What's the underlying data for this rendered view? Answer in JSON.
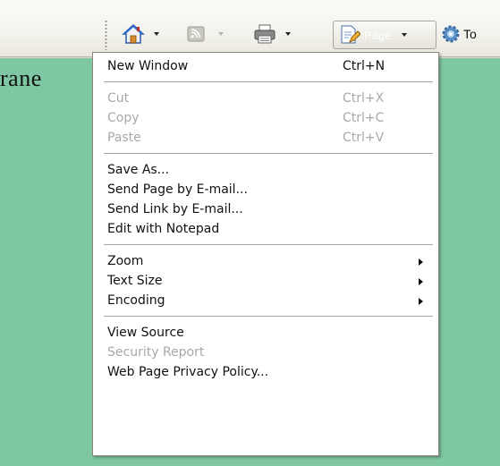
{
  "toolbar": {
    "page_label": "Page",
    "tools_label": "To",
    "buttons": [
      {
        "name": "home",
        "icon": "house-icon"
      },
      {
        "name": "feeds",
        "icon": "rss-feed-icon"
      },
      {
        "name": "print",
        "icon": "printer-icon"
      },
      {
        "name": "page",
        "icon": "page-edit-icon"
      },
      {
        "name": "tools",
        "icon": "gear-icon"
      }
    ]
  },
  "background_text": "rane",
  "menu": {
    "groups": [
      [
        {
          "label": "New Window",
          "shortcut": "Ctrl+N",
          "disabled": false
        }
      ],
      [
        {
          "label": "Cut",
          "shortcut": "Ctrl+X",
          "disabled": true
        },
        {
          "label": "Copy",
          "shortcut": "Ctrl+C",
          "disabled": true
        },
        {
          "label": "Paste",
          "shortcut": "Ctrl+V",
          "disabled": true
        }
      ],
      [
        {
          "label": "Save As...",
          "disabled": false
        },
        {
          "label": "Send Page by E-mail...",
          "disabled": false
        },
        {
          "label": "Send Link by E-mail...",
          "disabled": false
        },
        {
          "label": "Edit with Notepad",
          "disabled": false
        }
      ],
      [
        {
          "label": "Zoom",
          "submenu": true,
          "disabled": false
        },
        {
          "label": "Text Size",
          "submenu": true,
          "disabled": false
        },
        {
          "label": "Encoding",
          "submenu": true,
          "disabled": false
        }
      ],
      [
        {
          "label": "View Source",
          "disabled": false
        },
        {
          "label": "Security Report",
          "disabled": true
        },
        {
          "label": "Web Page Privacy Policy...",
          "disabled": false
        }
      ]
    ]
  },
  "colors": {
    "page_background": "#7fc7a3",
    "menu_background": "#ffffff",
    "disabled_text": "#a8a8a8"
  }
}
